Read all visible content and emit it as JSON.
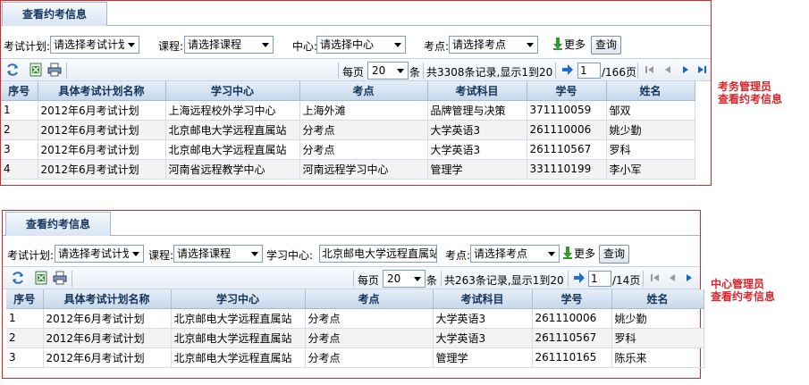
{
  "panel1": {
    "tab": "查看约考信息",
    "filters": {
      "plan_label": "考试计划:",
      "plan_value": "请选择考试计划",
      "course_label": "课程:",
      "course_value": "请选择课程",
      "center_label": "中心:",
      "center_value": "请选择中心",
      "site_label": "考点:",
      "site_value": "请选择考点",
      "more_label": "更多",
      "query_label": "查询"
    },
    "pager": {
      "per_page_label": "每页",
      "per_page": "20",
      "unit": "条",
      "summary": "共3308条记录,显示1到20",
      "page": "1",
      "total": "/166页"
    },
    "columns": [
      "序号",
      "具体考试计划名称",
      "学习中心",
      "考点",
      "考试科目",
      "学号",
      "姓名"
    ],
    "rows": [
      [
        "1",
        "2012年6月考试计划",
        "上海远程校外学习中心",
        "上海外滩",
        "品牌管理与决策",
        "371110059",
        "邹双"
      ],
      [
        "2",
        "2012年6月考试计划",
        "北京邮电大学远程直属站",
        "分考点",
        "大学英语3",
        "261110006",
        "姚少勤"
      ],
      [
        "3",
        "2012年6月考试计划",
        "北京邮电大学远程直属站",
        "分考点",
        "大学英语3",
        "261110567",
        "罗科"
      ],
      [
        "4",
        "2012年6月考试计划",
        "河南省远程教学中心",
        "河南远程学习中心",
        "管理学",
        "331110199",
        "李小军"
      ]
    ],
    "note_line1": "考务管理员",
    "note_line2": "查看约考信息"
  },
  "panel2": {
    "tab": "查看约考信息",
    "filters": {
      "plan_label": "考试计划:",
      "plan_value": "请选择考试计划",
      "course_label": "课程:",
      "course_value": "请选择课程",
      "center_label": "学习中心:",
      "center_value": "北京邮电大学远程直属站",
      "site_label": "考点:",
      "site_value": "请选择考点",
      "more_label": "更多",
      "query_label": "查询"
    },
    "pager": {
      "per_page_label": "每页",
      "per_page": "20",
      "unit": "条",
      "summary": "共263条记录,显示1到20",
      "page": "1",
      "total": "/14页"
    },
    "columns": [
      "序号",
      "具体考试计划名称",
      "学习中心",
      "考点",
      "考试科目",
      "学号",
      "姓名"
    ],
    "rows": [
      [
        "1",
        "2012年6月考试计划",
        "北京邮电大学远程直属站",
        "分考点",
        "大学英语3",
        "261110006",
        "姚少勤"
      ],
      [
        "2",
        "2012年6月考试计划",
        "北京邮电大学远程直属站",
        "分考点",
        "大学英语3",
        "261110567",
        "罗科"
      ],
      [
        "3",
        "2012年6月考试计划",
        "北京邮电大学远程直属站",
        "分考点",
        "管理学",
        "261110165",
        "陈乐来"
      ]
    ],
    "note_line1": "中心管理员",
    "note_line2": "查看约考信息"
  }
}
